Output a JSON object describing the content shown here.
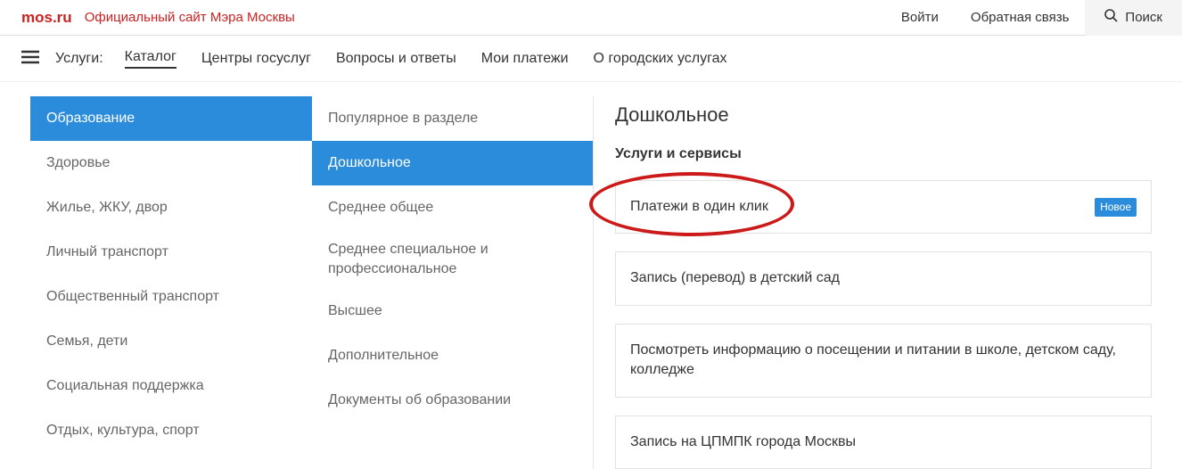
{
  "topbar": {
    "logo": "mos.ru",
    "tagline": "Официальный сайт Мэра Москвы",
    "login": "Войти",
    "feedback": "Обратная связь",
    "search": "Поиск"
  },
  "nav": {
    "label": "Услуги:",
    "items": [
      "Каталог",
      "Центры госуслуг",
      "Вопросы и ответы",
      "Мои платежи",
      "О городских услугах"
    ]
  },
  "categories": [
    "Образование",
    "Здоровье",
    "Жилье, ЖКУ, двор",
    "Личный транспорт",
    "Общественный транспорт",
    "Семья, дети",
    "Социальная поддержка",
    "Отдых, культура, спорт"
  ],
  "subcategories": [
    "Популярное в разделе",
    "Дошкольное",
    "Среднее общее",
    "Среднее специальное и профессиональное",
    "Высшее",
    "Дополнительное",
    "Документы об образовании"
  ],
  "detail": {
    "title": "Дошкольное",
    "subtitle": "Услуги и сервисы",
    "badge_new": "Новое",
    "services": [
      "Платежи в один клик",
      "Запись (перевод) в детский сад",
      "Посмотреть информацию о посещении и питании в школе, детском саду, колледже",
      "Запись на ЦПМПК города Москвы"
    ]
  }
}
